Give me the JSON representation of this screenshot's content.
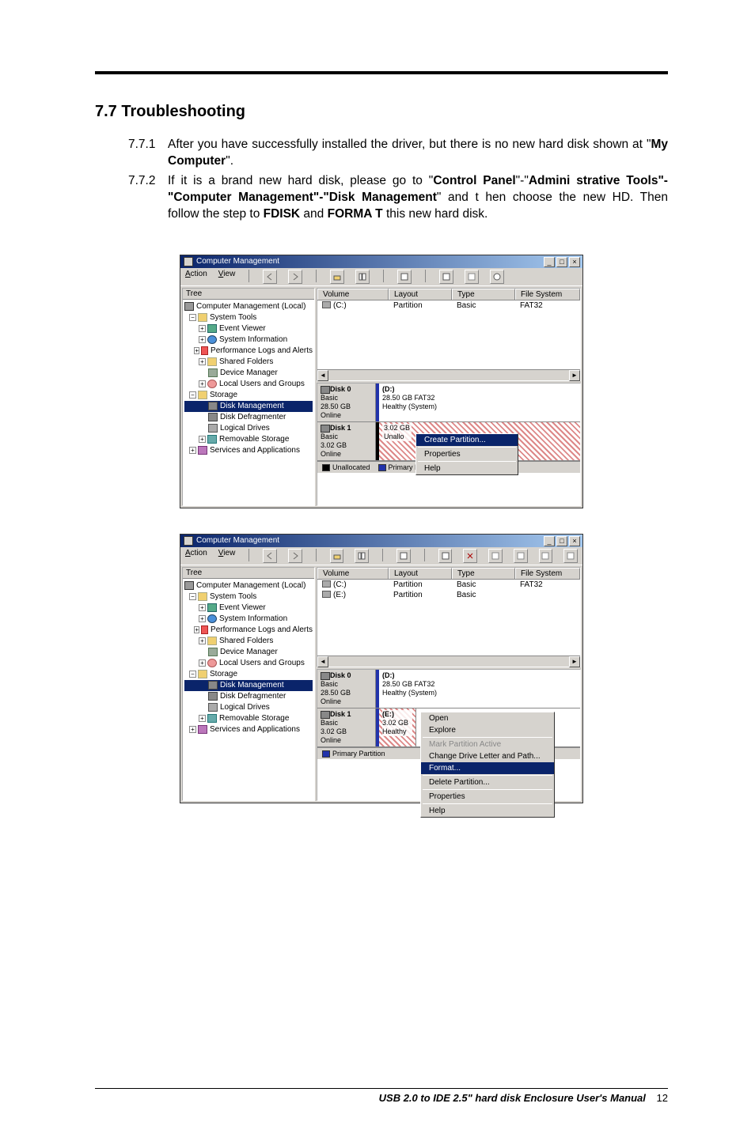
{
  "page": {
    "section_number": "7.7",
    "section_title": "Troubleshooting",
    "items": [
      {
        "num": "7.7.1",
        "html": "After you have successfully installed the driver, but there is no new hard disk shown at \"<b>My Computer</b>\"."
      },
      {
        "num": "7.7.2",
        "html": "If it is a brand new hard disk, please go to \"<b>Control Panel</b>\"-\"<b>Admini strative Tools\"-\"Computer Management\"-\"Disk Management</b>\" and t hen choose the new HD. Then follow the step to <b>FDISK</b> and <b>FORMA T</b> this new hard disk."
      }
    ]
  },
  "window": {
    "title": "Computer Management",
    "title_btns": {
      "min": "_",
      "max": "□",
      "close": "×"
    },
    "menus": {
      "action": "Action",
      "view": "View"
    },
    "tree_tab": "Tree",
    "tree": {
      "root": "Computer Management (Local)",
      "system_tools": "System Tools",
      "event_viewer": "Event Viewer",
      "system_info": "System Information",
      "perf_logs": "Performance Logs and Alerts",
      "shared_folders": "Shared Folders",
      "device_manager": "Device Manager",
      "local_users": "Local Users and Groups",
      "storage": "Storage",
      "disk_mgmt": "Disk Management",
      "disk_defrag": "Disk Defragmenter",
      "logical_drives": "Logical Drives",
      "removable_storage": "Removable Storage",
      "services_apps": "Services and Applications"
    },
    "list_headers": {
      "volume": "Volume",
      "layout": "Layout",
      "type": "Type",
      "fs": "File System"
    },
    "volumes": {
      "c": {
        "name": "(C:)",
        "layout": "Partition",
        "type": "Basic",
        "fs": "FAT32"
      },
      "e": {
        "name": "(E:)",
        "layout": "Partition",
        "type": "Basic",
        "fs": ""
      }
    },
    "disks": {
      "disk0": {
        "label": "Disk 0",
        "kind": "Basic",
        "size": "28.50 GB",
        "status": "Online",
        "part_name": "(D:)",
        "part_desc1": "28.50 GB FAT32",
        "part_desc2": "Healthy (System)"
      },
      "disk1_a": {
        "label": "Disk 1",
        "kind": "Basic",
        "size": "3.02 GB",
        "status": "Online",
        "part_desc1": "3.02 GB",
        "part_desc2": "Unallo"
      },
      "disk1_b": {
        "label": "Disk 1",
        "kind": "Basic",
        "size": "3.02 GB",
        "status": "Online",
        "part_name": "(E:)",
        "part_desc1": "3.02 GB",
        "part_desc2": "Healthy"
      }
    },
    "legend": {
      "unallocated": "Unallocated",
      "primary": "Primary Partion",
      "primary_full": "Primary Partition"
    },
    "context_menu_a": {
      "create": "Create Partition...",
      "properties": "Properties",
      "help": "Help"
    },
    "context_menu_b": {
      "open": "Open",
      "explore": "Explore",
      "mark_active": "Mark Partition Active",
      "change_letter": "Change Drive Letter and Path...",
      "format": "Format...",
      "delete": "Delete Partition...",
      "properties": "Properties",
      "help": "Help"
    }
  },
  "footer": {
    "doc_title": "USB 2.0 to IDE 2.5\" hard disk Enclosure User's Manual",
    "page_no": "12"
  }
}
